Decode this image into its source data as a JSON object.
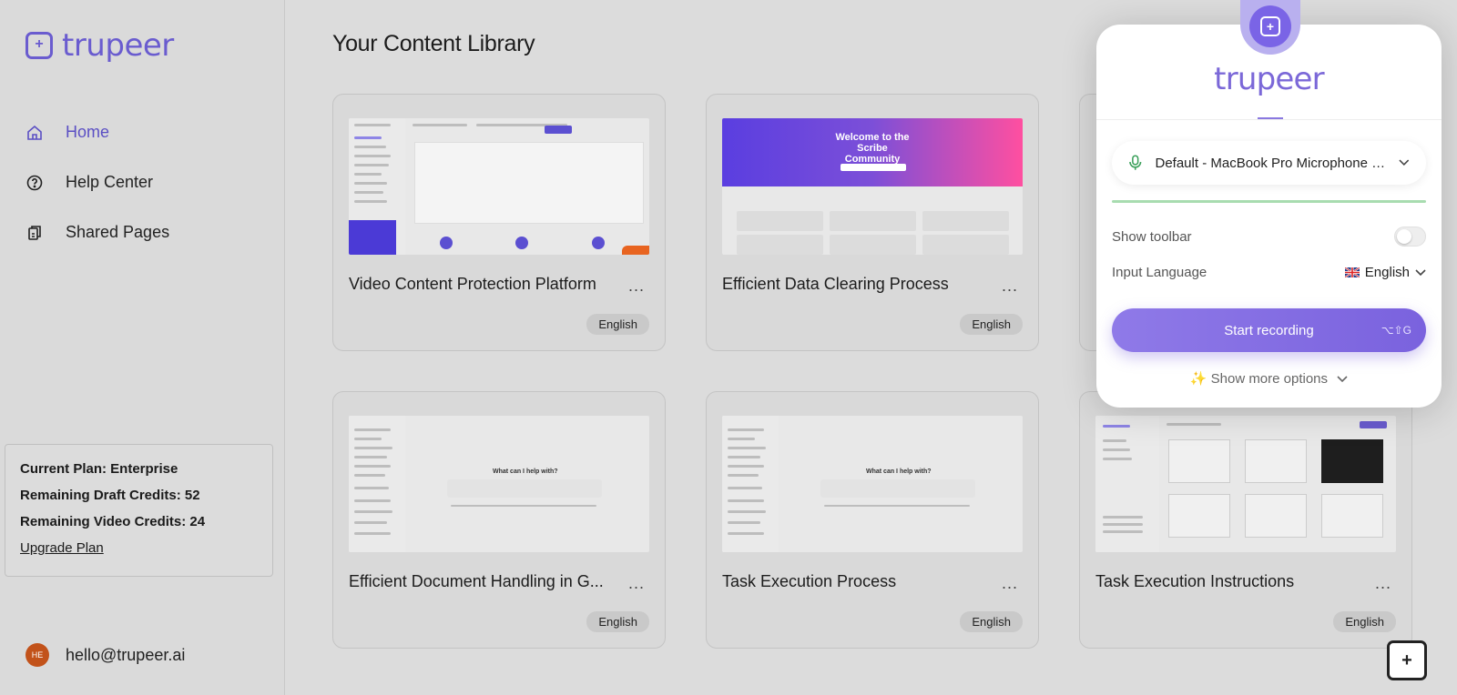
{
  "sidebar": {
    "logo_text": "trupeer",
    "items": [
      {
        "label": "Home"
      },
      {
        "label": "Help Center"
      },
      {
        "label": "Shared Pages"
      }
    ],
    "plan": {
      "current_plan": "Current Plan: Enterprise",
      "draft_credits": "Remaining Draft Credits: 52",
      "video_credits": "Remaining Video Credits: 24",
      "upgrade_label": "Upgrade Plan"
    },
    "user": {
      "avatar_initials": "HE",
      "email": "hello@trupeer.ai"
    }
  },
  "main": {
    "title": "Your Content Library",
    "more_label": "...",
    "cards": [
      {
        "title": "Video Content Protection Platform",
        "language": "English"
      },
      {
        "title": "Efficient Data Clearing Process",
        "language": "English"
      },
      {
        "title": "Efficient Document Handling in G...",
        "language": "English"
      },
      {
        "title": "Task Execution Process",
        "language": "English"
      },
      {
        "title": "Task Execution Instructions",
        "language": "English"
      }
    ],
    "thumb_text": {
      "banner": "Welcome to the Scribe Community",
      "chat_prompt": "What can I help with?"
    }
  },
  "recorder": {
    "logo_text": "trupeer",
    "microphone": "Default - MacBook Pro Microphone (...",
    "show_toolbar_label": "Show toolbar",
    "show_toolbar_on": false,
    "input_language_label": "Input Language",
    "input_language_value": "English",
    "start_label": "Start recording",
    "start_shortcut": "⌥⇧G",
    "more_options_label": "✨ Show more options",
    "accent_color": "#7a62de"
  },
  "icons": {
    "home": "home-icon",
    "help": "help-circle-icon",
    "shared": "shared-pages-icon",
    "mic": "microphone-icon",
    "chevron": "chevron-down-icon",
    "flag": "uk-flag-icon"
  }
}
